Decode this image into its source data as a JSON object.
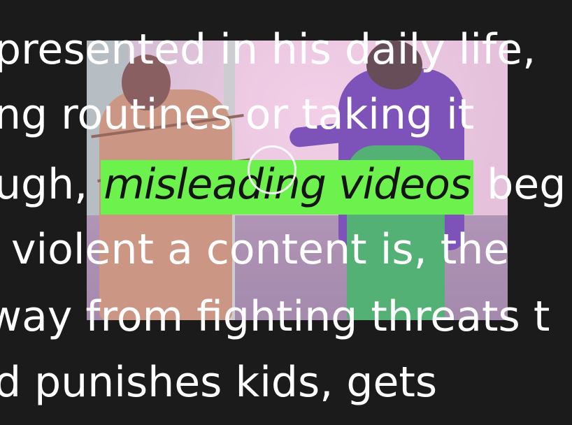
{
  "text_lines": {
    "line1": "presented in his daily life,",
    "line2": "ng routines or taking it",
    "line3_before": "ugh,",
    "line3_highlight": "misleading videos",
    "line3_after": "beg",
    "line4": "violent a content is, the",
    "line5": "way from fighting threats t",
    "line6": "d punishes kids, gets"
  },
  "colors": {
    "background": "#1b1b1b",
    "text": "#ffffff",
    "highlight": "#6df24d"
  },
  "video": {
    "icon": "play-ring-icon"
  }
}
